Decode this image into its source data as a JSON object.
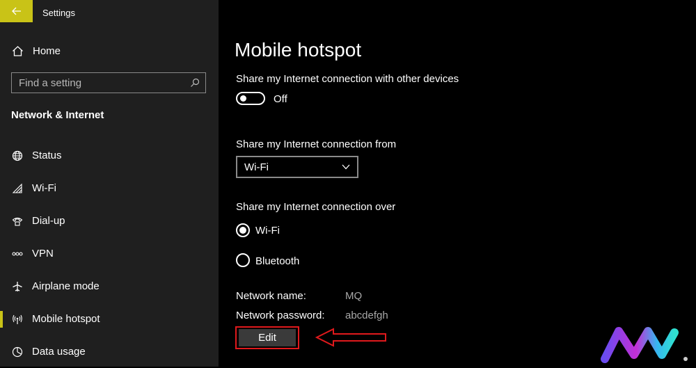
{
  "app": {
    "title": "Settings"
  },
  "sidebar": {
    "home_label": "Home",
    "search_placeholder": "Find a setting",
    "section_title": "Network & Internet",
    "items": [
      {
        "label": "Status",
        "icon": "globe-icon"
      },
      {
        "label": "Wi-Fi",
        "icon": "wifi-icon"
      },
      {
        "label": "Dial-up",
        "icon": "phone-icon"
      },
      {
        "label": "VPN",
        "icon": "vpn-icon"
      },
      {
        "label": "Airplane mode",
        "icon": "airplane-icon"
      },
      {
        "label": "Mobile hotspot",
        "icon": "hotspot-icon",
        "active": true
      },
      {
        "label": "Data usage",
        "icon": "data-usage-icon"
      }
    ]
  },
  "main": {
    "title": "Mobile hotspot",
    "share_label": "Share my Internet connection with other devices",
    "toggle_state": "Off",
    "from_label": "Share my Internet connection from",
    "from_selected": "Wi-Fi",
    "over_label": "Share my Internet connection over",
    "over_options": [
      {
        "label": "Wi-Fi",
        "selected": true
      },
      {
        "label": "Bluetooth",
        "selected": false
      }
    ],
    "network_name_label": "Network name:",
    "network_name_value": "MQ",
    "network_password_label": "Network password:",
    "network_password_value": "abcdefgh",
    "edit_label": "Edit"
  },
  "colors": {
    "accent": "#c9c317",
    "highlight": "#e0191c",
    "sidebar_bg": "#1f1f1f",
    "main_bg": "#000000"
  }
}
